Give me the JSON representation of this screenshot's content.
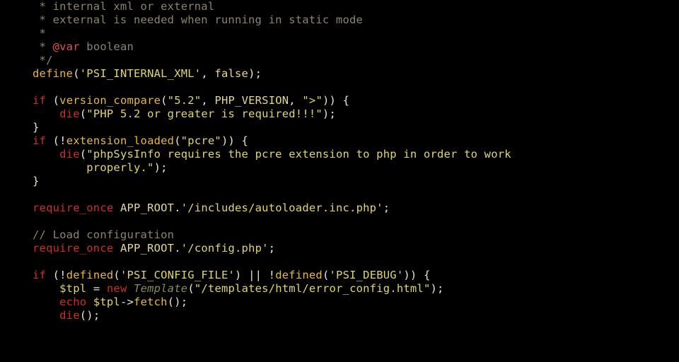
{
  "lines": {
    "c1": " * internal xml or external",
    "c2": " * external is needed when running in static mode",
    "c3": " *",
    "c4a": " * ",
    "c4tag": "@var",
    "c4b": " boolean",
    "c5": " */",
    "def_kw": "define",
    "def_arg1": "'PSI_INTERNAL_XML'",
    "def_arg2": "false",
    "if": "if",
    "vc_fn": "version_compare",
    "vc_a1": "\"5.2\"",
    "vc_a2": "PHP_VERSION",
    "vc_a3": "\">\"",
    "die": "die",
    "die1": "\"PHP 5.2 or greater is required!!!\"",
    "el_fn": "extension_loaded",
    "el_arg": "\"pcre\"",
    "die2a": "\"phpSysInfo requires the pcre extension to php in order to work",
    "die2b": "properly.\"",
    "req": "require_once",
    "approot": "APP_ROOT",
    "inc1": "'/includes/autoloader.inc.php'",
    "loadcfg": "// Load configuration",
    "inc2": "'/config.php'",
    "defd": "defined",
    "cfgfile": "'PSI_CONFIG_FILE'",
    "dbg": "'PSI_DEBUG'",
    "tplvar": "$tpl",
    "new": "new",
    "tplcls": "Template",
    "tplarg": "\"/templates/html/error_config.html\"",
    "echo": "echo",
    "fetch": "fetch"
  }
}
